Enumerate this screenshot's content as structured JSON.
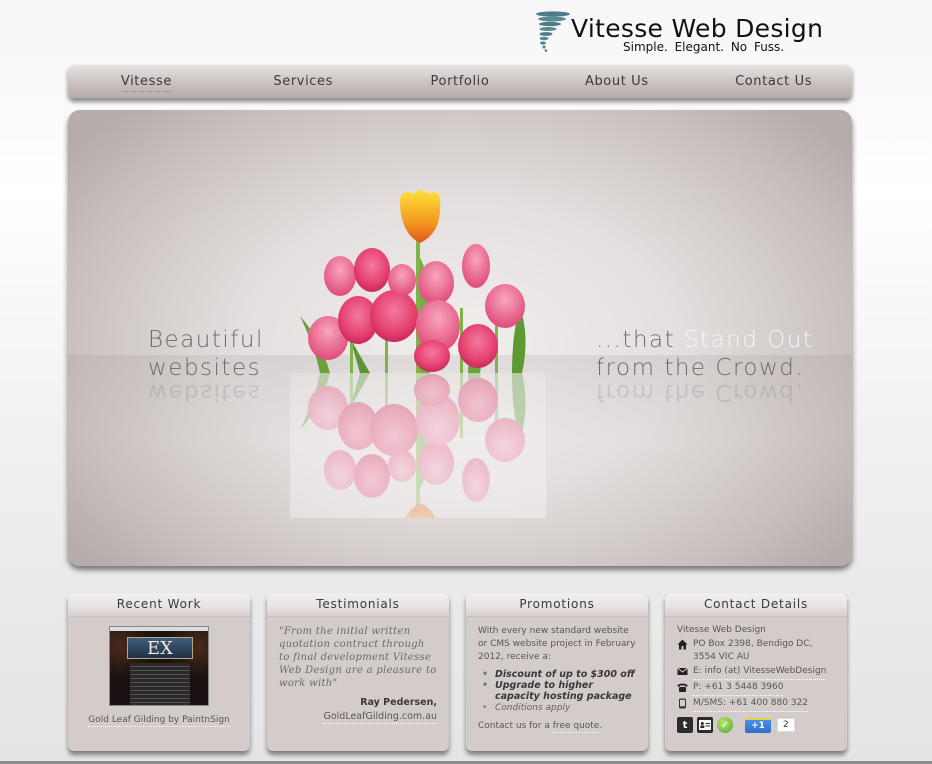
{
  "brand": {
    "title": "Vitesse Web Design",
    "tagline": "Simple.  Elegant.  No Fuss.",
    "logo_icon": "tornado-icon",
    "logo_color": "#4d7b87"
  },
  "nav": {
    "items": [
      {
        "label": "Vitesse",
        "active": true
      },
      {
        "label": "Services",
        "active": false
      },
      {
        "label": "Portfolio",
        "active": false
      },
      {
        "label": "About Us",
        "active": false
      },
      {
        "label": "Contact Us",
        "active": false
      }
    ]
  },
  "banner": {
    "left_line1": "Beautiful",
    "left_line2": "websites",
    "right_line1_prefix": "...that ",
    "right_line1_highlight": "Stand Out",
    "right_line2": "from the Crowd.",
    "image": "pink-and-yellow-tulips"
  },
  "boxes": {
    "recent_work": {
      "title": "Recent Work",
      "thumb_text": "EX",
      "caption": "Gold Leaf Gilding by PaintnSign"
    },
    "testimonials": {
      "title": "Testimonials",
      "quote": "\"From the initial written quotation contract through to final development Vitesse Web Design are a pleasure to work with\"",
      "author": "Ray Pedersen,",
      "site": "GoldLeafGilding.com.au"
    },
    "promotions": {
      "title": "Promotions",
      "intro": "With every new standard website or CMS website project in February 2012, receive a:",
      "items": [
        "Discount of up to $300 off",
        "Upgrade to higher capacity hosting package"
      ],
      "condition": "Conditions apply",
      "cta_prefix": "Contact us for a ",
      "cta_link": "free quote",
      "cta_suffix": "."
    },
    "contact": {
      "title": "Contact Details",
      "company": "Vitesse Web Design",
      "address": "PO Box 2398, Bendigo DC, 3554 VIC AU",
      "email": "E: info (at) VitesseWebDesign",
      "phone": "P: +61 3 5448 3960",
      "mobile": "M/SMS: +61 400 880 322",
      "gplus_label": "+1",
      "gplus_count": "2"
    }
  }
}
